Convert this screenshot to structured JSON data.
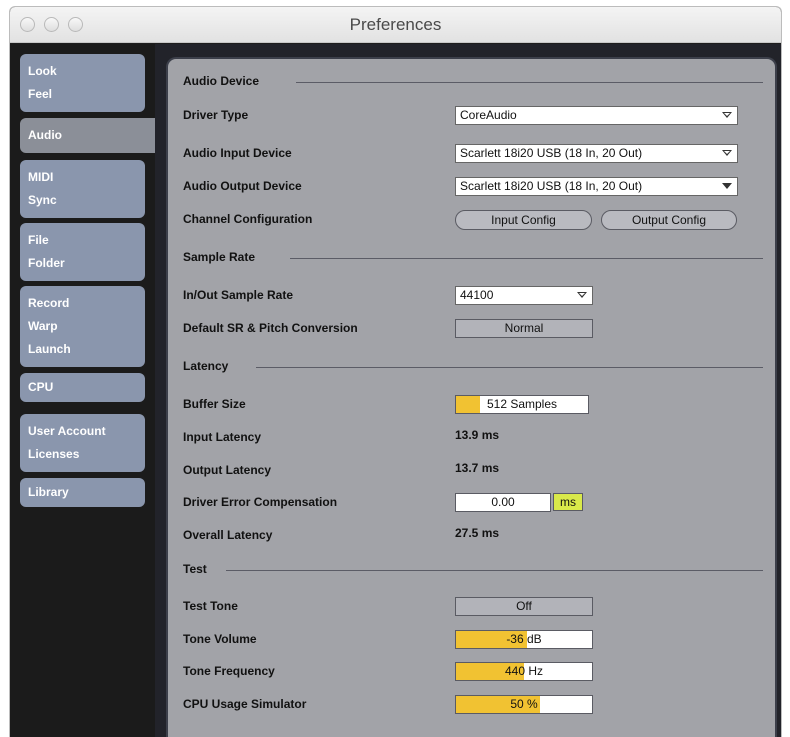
{
  "window": {
    "title": "Preferences"
  },
  "sidebar": {
    "tabs": [
      {
        "lines": [
          "Look",
          "Feel"
        ]
      },
      {
        "lines": [
          "Audio"
        ]
      },
      {
        "lines": [
          "MIDI",
          "Sync"
        ]
      },
      {
        "lines": [
          "File",
          "Folder"
        ]
      },
      {
        "lines": [
          "Record",
          "Warp",
          "Launch"
        ]
      },
      {
        "lines": [
          "CPU"
        ]
      },
      {
        "lines": [
          "User Account",
          "Licenses"
        ]
      },
      {
        "lines": [
          "Library"
        ]
      }
    ],
    "active_index": 1
  },
  "audio_device": {
    "section_title": "Audio Device",
    "driver_type": {
      "label": "Driver Type",
      "value": "CoreAudio"
    },
    "input_device": {
      "label": "Audio Input Device",
      "value": "Scarlett 18i20 USB (18 In, 20 Out)"
    },
    "output_device": {
      "label": "Audio Output Device",
      "value": "Scarlett 18i20 USB (18 In, 20 Out)"
    },
    "channel_config": {
      "label": "Channel Configuration",
      "input_button": "Input Config",
      "output_button": "Output Config"
    }
  },
  "sample_rate": {
    "section_title": "Sample Rate",
    "rate": {
      "label": "In/Out Sample Rate",
      "value": "44100"
    },
    "conversion": {
      "label": "Default SR & Pitch Conversion",
      "value": "Normal"
    }
  },
  "latency": {
    "section_title": "Latency",
    "buffer_size": {
      "label": "Buffer Size",
      "value": "512 Samples",
      "fill_fraction": 0.18
    },
    "input_latency": {
      "label": "Input Latency",
      "value": "13.9 ms"
    },
    "output_latency": {
      "label": "Output Latency",
      "value": "13.7 ms"
    },
    "driver_error": {
      "label": "Driver Error Compensation",
      "value": "0.00",
      "unit": "ms"
    },
    "overall_latency": {
      "label": "Overall Latency",
      "value": "27.5 ms"
    }
  },
  "test": {
    "section_title": "Test",
    "test_tone": {
      "label": "Test Tone",
      "value": "Off"
    },
    "tone_volume": {
      "label": "Tone Volume",
      "value": "-36",
      "unit": "dB",
      "fill_fraction": 0.52
    },
    "tone_frequency": {
      "label": "Tone Frequency",
      "value": "440",
      "unit": "Hz",
      "fill_fraction": 0.5
    },
    "cpu_simulator": {
      "label": "CPU Usage Simulator",
      "value": "50",
      "unit": "%",
      "fill_fraction": 0.62
    }
  },
  "colors": {
    "accent_fill": "#f1c232",
    "ms_unit": "#d9e94a",
    "sidebar_tab": "#8a96ad",
    "panel": "#a2a3a8"
  }
}
